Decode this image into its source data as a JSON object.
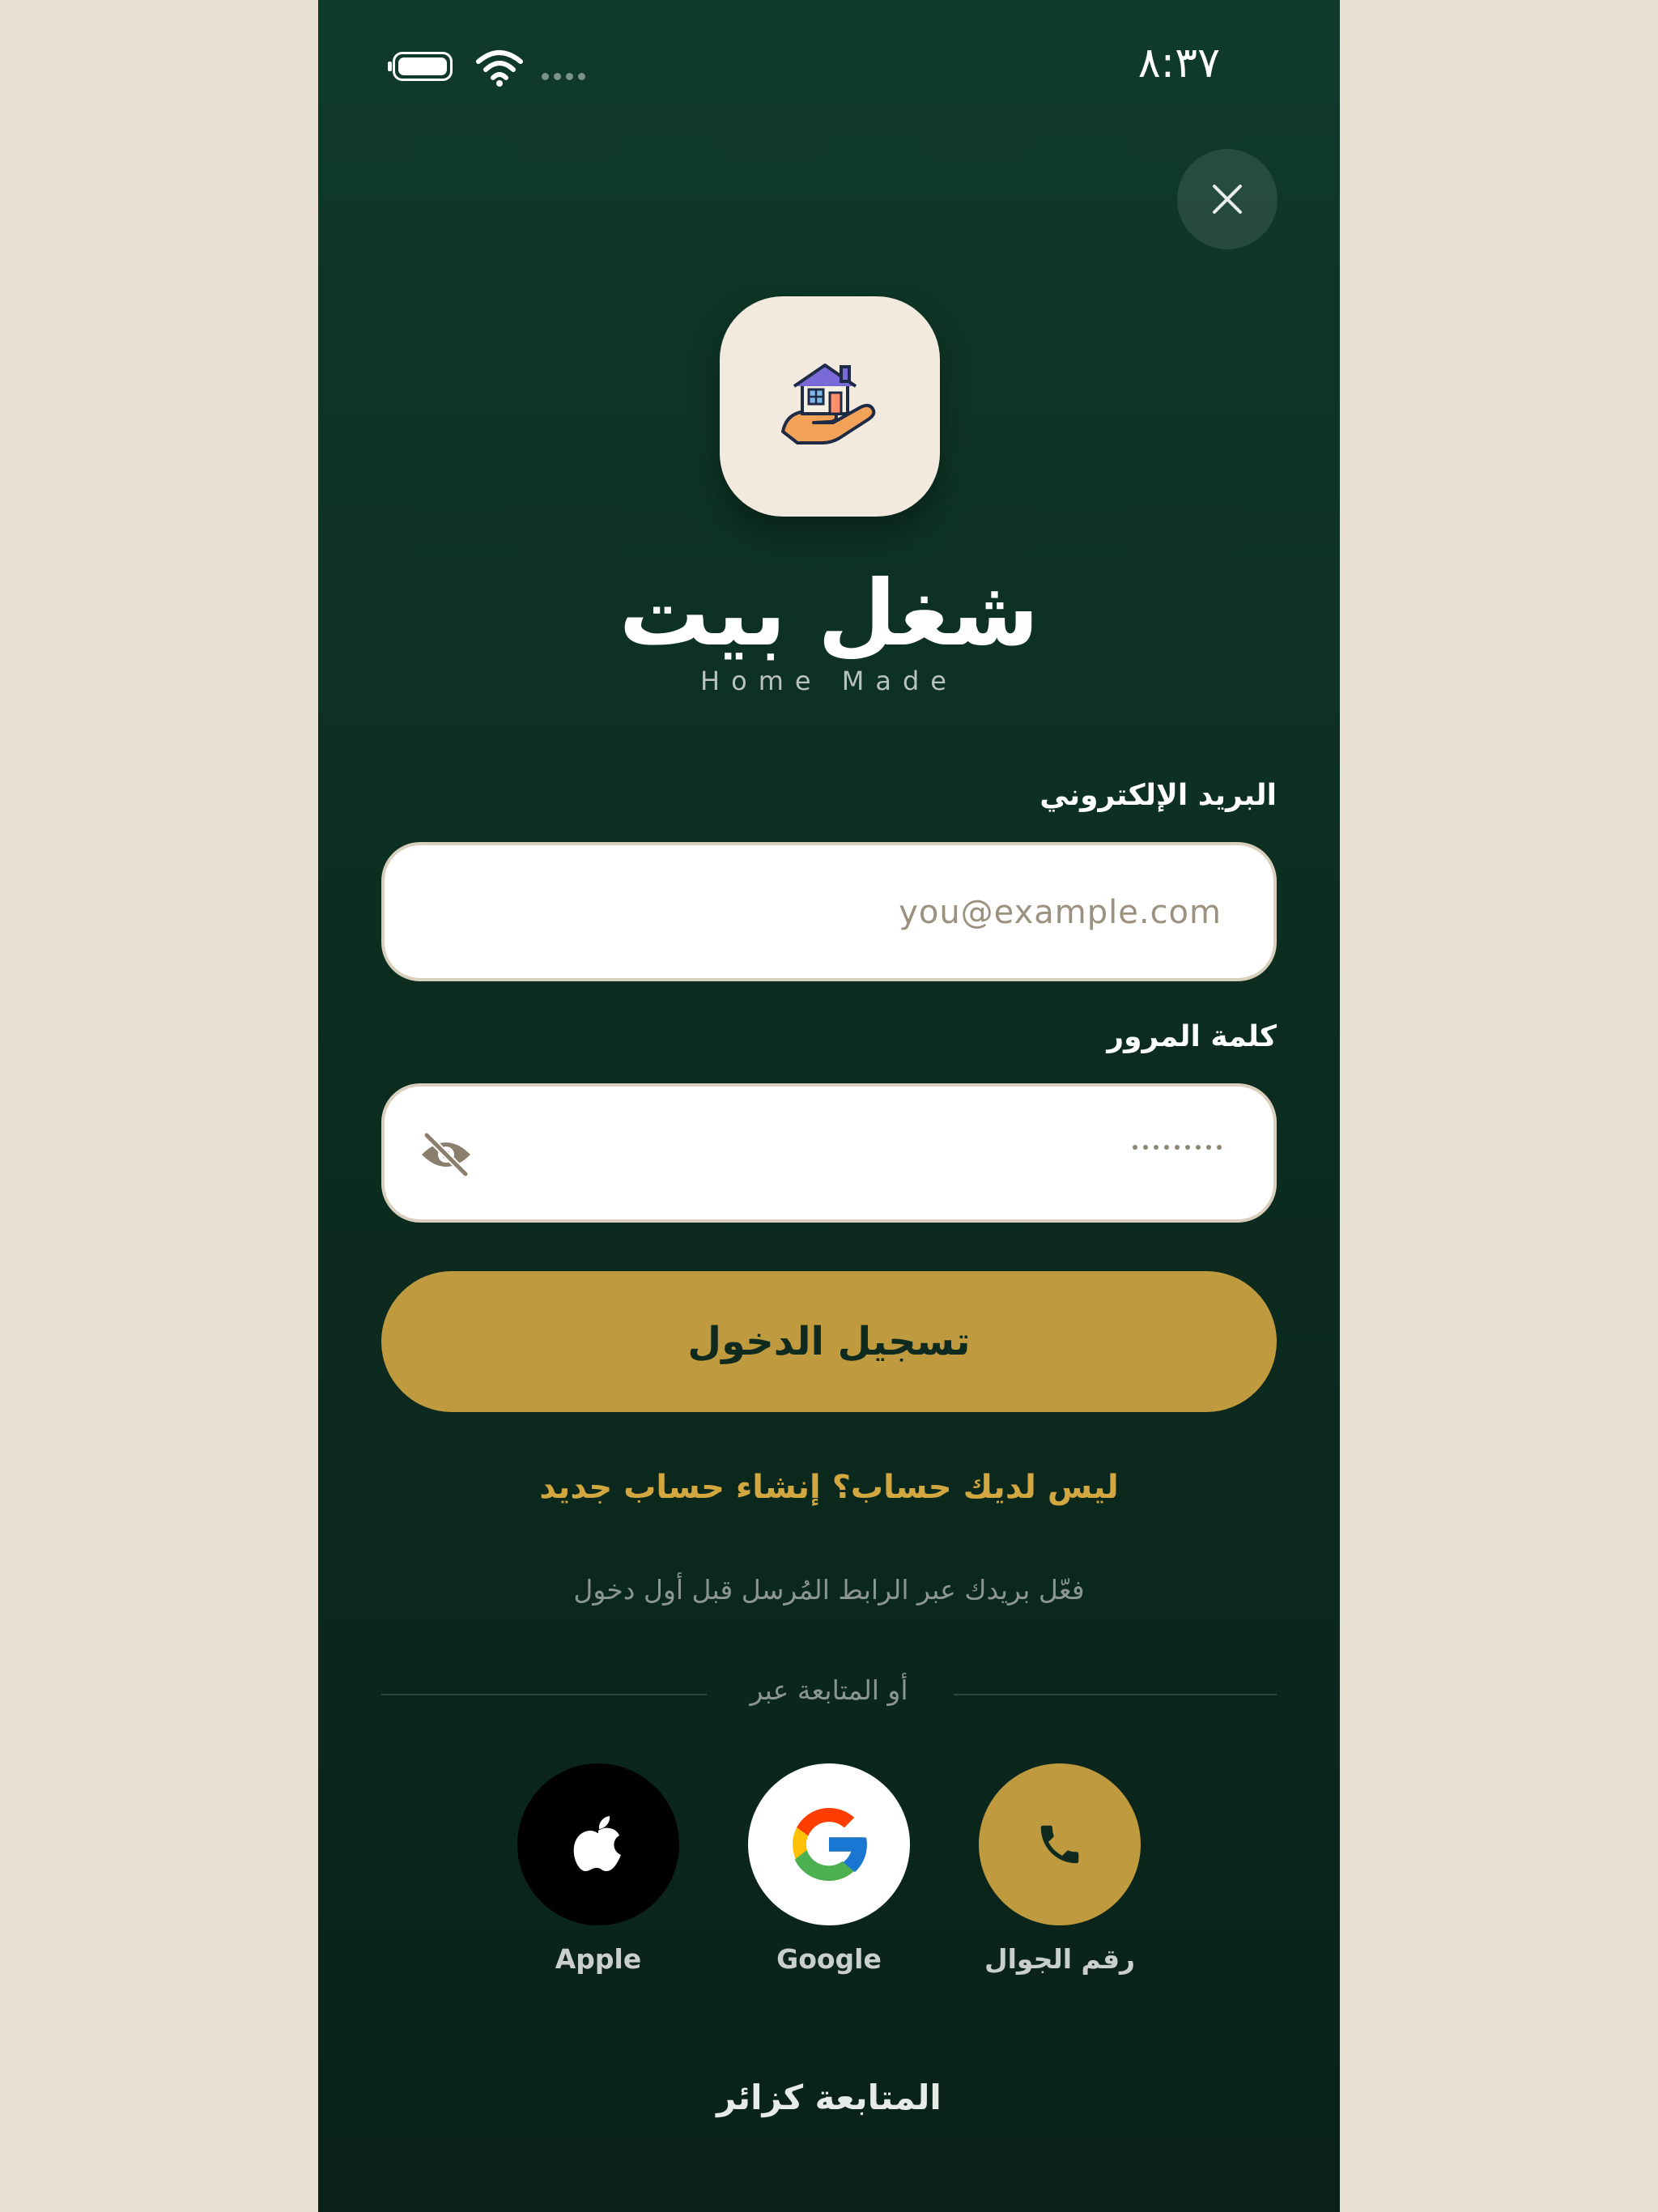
{
  "status_bar": {
    "time": "٨:٣٧"
  },
  "icons": {
    "close": "close-icon",
    "logo": "house-in-hand-icon",
    "eye": "eye-off-icon",
    "apple": "apple-icon",
    "google": "google-icon",
    "phone": "phone-icon"
  },
  "brand": {
    "name": "شغل بيت",
    "tagline": "Home Made"
  },
  "form": {
    "email_label": "البريد الإلكتروني",
    "email_placeholder": "you@example.com",
    "password_label": "كلمة المرور",
    "password_value": "••••••••",
    "login_label": "تسجيل الدخول"
  },
  "links": {
    "signup": "ليس لديك حساب؟ إنشاء حساب جديد",
    "hint": "فعّل بريدك عبر الرابط المُرسل قبل أول دخول",
    "divider": "أو المتابعة عبر",
    "guest": "المتابعة كزائر"
  },
  "social": [
    {
      "label": "Apple"
    },
    {
      "label": "Google"
    },
    {
      "label": "رقم الجوال"
    }
  ],
  "colors": {
    "background_dark": "#0c2d20",
    "accent_gold": "#c09a3e",
    "page_bg": "#e8e0d2"
  }
}
